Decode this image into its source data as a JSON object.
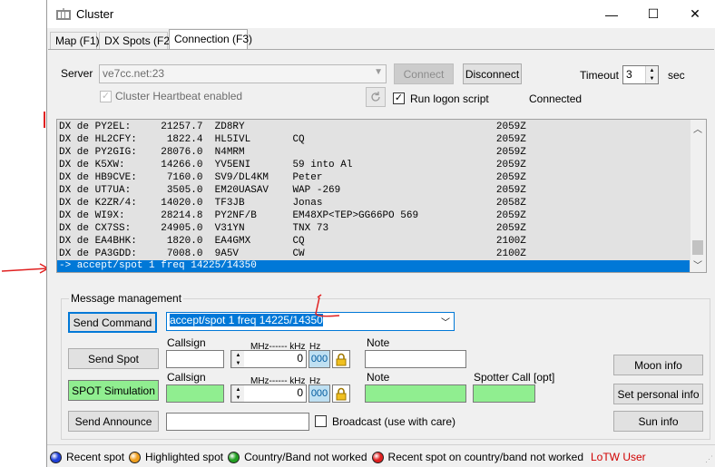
{
  "window": {
    "title": "Cluster",
    "minimize_glyph": "—",
    "maximize_glyph": "☐",
    "close_glyph": "✕"
  },
  "tabs": [
    {
      "label": "Map (F1)"
    },
    {
      "label": "DX Spots (F2)"
    },
    {
      "label": "Connection (F3)"
    }
  ],
  "connection": {
    "server_label": "Server",
    "server_value": "ve7cc.net:23",
    "connect_label": "Connect",
    "disconnect_label": "Disconnect",
    "timeout_label": "Timeout",
    "timeout_value": "3",
    "timeout_unit": "sec",
    "heartbeat_label": "Cluster Heartbeat enabled",
    "logon_script_label": "Run logon script",
    "status": "Connected"
  },
  "console_lines": [
    {
      "text": "DX de PY2EL:     21257.7  ZD8RY                                          2059Z"
    },
    {
      "text": "DX de HL2CFY:     1822.4  HL5IVL       CQ                                2059Z"
    },
    {
      "text": "DX de PY2GIG:    28076.0  N4MRM                                          2059Z"
    },
    {
      "text": "DX de K5XW:      14266.0  YV5ENI       59 into Al                        2059Z"
    },
    {
      "text": "DX de HB9CVE:     7160.0  SV9/DL4KM    Peter                             2059Z"
    },
    {
      "text": "DX de UT7UA:      3505.0  EM20UASAV    WAP -269                          2059Z"
    },
    {
      "text": "DX de K2ZR/4:    14020.0  TF3JB        Jonas                             2058Z"
    },
    {
      "text": "DX de WI9X:      28214.8  PY2NF/B      EM48XP<TEP>GG66PO 569             2059Z"
    },
    {
      "text": "DX de CX7SS:     24905.0  V31YN        TNX 73                            2059Z"
    },
    {
      "text": "DX de EA4BHK:     1820.0  EA4GMX       CQ                                2100Z"
    },
    {
      "text": "DX de PA3GDD:     7008.0  9A5V         CW                                2100Z"
    },
    {
      "text": "-> accept/spot 1 freq 14225/14350"
    }
  ],
  "message_management": {
    "title": "Message management",
    "send_command_label": "Send Command",
    "command_value": "accept/spot 1 freq 14225/14350",
    "send_spot_label": "Send Spot",
    "spot_simulation_label": "SPOT Simulation",
    "send_announce_label": "Send Announce",
    "callsign_label": "Callsign",
    "mhz_khz_label": "MHz------ kHz",
    "hz_label": "Hz",
    "freq_value": "0",
    "hz_value": "000",
    "note_label": "Note",
    "spotter_label": "Spotter Call [opt]",
    "broadcast_label": "Broadcast (use with care)",
    "moon_info_label": "Moon info",
    "set_personal_label": "Set personal info",
    "sun_info_label": "Sun info"
  },
  "legend": {
    "items": [
      {
        "label": "Recent spot",
        "color": "#1f3fd8"
      },
      {
        "label": "Highlighted spot",
        "color": "#f0a020"
      },
      {
        "label": "Country/Band not worked",
        "color": "#22a022"
      },
      {
        "label": "Recent spot on country/band not worked",
        "color": "#e02020"
      }
    ],
    "lotw_label": "LoTW User",
    "lotw_color": "#d00000"
  },
  "colors": {
    "selection": "#0078d7",
    "green_field": "#90ee90",
    "annotation": "#e02020"
  }
}
